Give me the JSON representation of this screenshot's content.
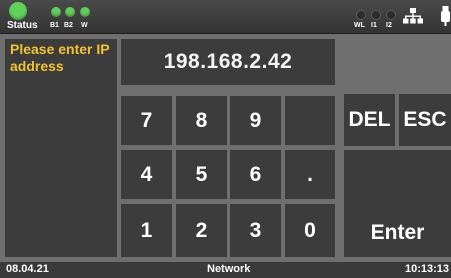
{
  "status_bar": {
    "status_label": "Status",
    "indicators_left": [
      "B1",
      "B2",
      "W"
    ],
    "indicators_right": [
      "WL",
      "I1",
      "I2"
    ],
    "led_on_color": "#5fd05a",
    "icons": [
      "network-icon",
      "usb-icon"
    ]
  },
  "prompt": {
    "text": "Please enter IP address",
    "color": "#f2c12e"
  },
  "ip_display": {
    "value": "198.168.2.42"
  },
  "keypad": {
    "keys": [
      "7",
      "8",
      "9",
      "",
      "4",
      "5",
      "6",
      ".",
      "1",
      "2",
      "3",
      "0"
    ],
    "del_label": "DEL",
    "esc_label": "ESC",
    "enter_label": "Enter"
  },
  "footer": {
    "date": "08.04.21",
    "title": "Network",
    "time": "10:13:13"
  }
}
